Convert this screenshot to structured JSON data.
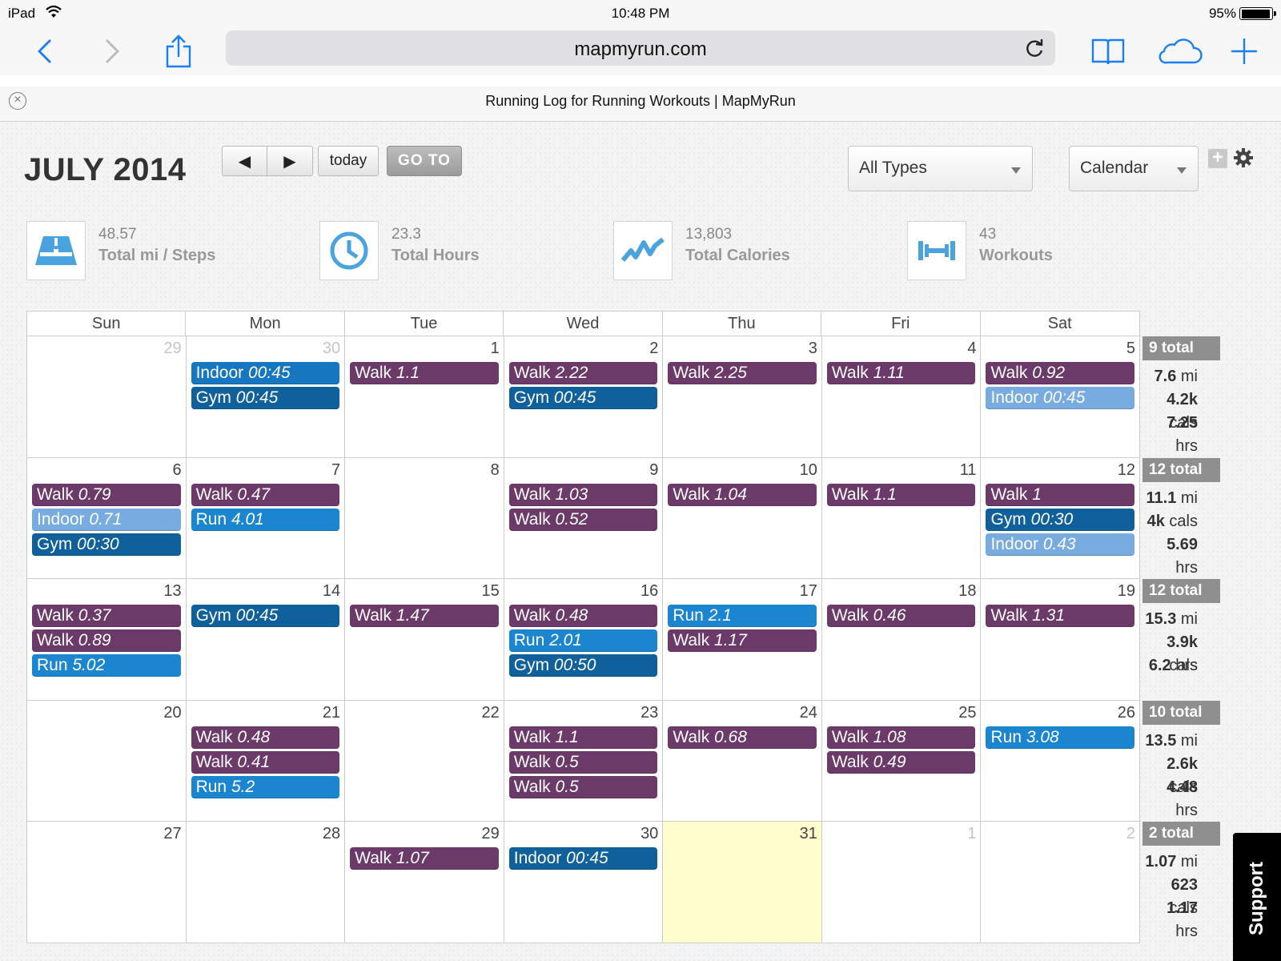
{
  "status_bar": {
    "device": "iPad",
    "time": "10:48 PM",
    "battery": "95%",
    "battery_level": 0.95
  },
  "browser": {
    "url": "mapmyrun.com",
    "tab_title": "Running Log for Running Workouts | MapMyRun"
  },
  "header": {
    "month_title": "JULY 2014",
    "prev_label": "◀",
    "next_label": "▶",
    "today_label": "today",
    "goto_label": "GO TO",
    "type_filter": "All Types",
    "view_select": "Calendar",
    "add_label": "+"
  },
  "stats": [
    {
      "value": "48.57",
      "label": "Total mi / Steps",
      "icon": "road-icon"
    },
    {
      "value": "23.3",
      "label": "Total Hours",
      "icon": "clock-icon"
    },
    {
      "value": "13,803",
      "label": "Total Calories",
      "icon": "pulse-icon"
    },
    {
      "value": "43",
      "label": "Workouts",
      "icon": "dumbbell-icon"
    }
  ],
  "colors": {
    "walk": "#6c3a69",
    "run": "#1b86cf",
    "gym": "#0f609b",
    "indoor": "#78abe0",
    "today_bg": "#fffccd"
  },
  "weekdays": [
    "Sun",
    "Mon",
    "Tue",
    "Wed",
    "Thu",
    "Fri",
    "Sat"
  ],
  "weeks": [
    {
      "days": [
        {
          "num": "29",
          "other": true,
          "events": []
        },
        {
          "num": "30",
          "other": true,
          "events": [
            {
              "type": "indoor-dark",
              "name": "Indoor",
              "value": "00:45"
            },
            {
              "type": "gym",
              "name": "Gym",
              "value": "00:45"
            }
          ]
        },
        {
          "num": "1",
          "events": [
            {
              "type": "walk",
              "name": "Walk",
              "value": "1.1"
            }
          ]
        },
        {
          "num": "2",
          "events": [
            {
              "type": "walk",
              "name": "Walk",
              "value": "2.22"
            },
            {
              "type": "gym",
              "name": "Gym",
              "value": "00:45"
            }
          ]
        },
        {
          "num": "3",
          "events": [
            {
              "type": "walk",
              "name": "Walk",
              "value": "2.25"
            }
          ]
        },
        {
          "num": "4",
          "events": [
            {
              "type": "walk",
              "name": "Walk",
              "value": "1.11"
            }
          ]
        },
        {
          "num": "5",
          "events": [
            {
              "type": "walk",
              "name": "Walk",
              "value": "0.92"
            },
            {
              "type": "indoor",
              "name": "Indoor",
              "value": "00:45"
            }
          ]
        }
      ],
      "total": {
        "badge": "9 total",
        "mi": "7.6",
        "cals": "4.2k",
        "hrs": "7.25"
      }
    },
    {
      "days": [
        {
          "num": "6",
          "events": [
            {
              "type": "walk",
              "name": "Walk",
              "value": "0.79"
            },
            {
              "type": "indoor",
              "name": "Indoor",
              "value": "0.71"
            },
            {
              "type": "gym",
              "name": "Gym",
              "value": "00:30"
            }
          ]
        },
        {
          "num": "7",
          "events": [
            {
              "type": "walk",
              "name": "Walk",
              "value": "0.47"
            },
            {
              "type": "run",
              "name": "Run",
              "value": "4.01"
            }
          ]
        },
        {
          "num": "8",
          "events": []
        },
        {
          "num": "9",
          "events": [
            {
              "type": "walk",
              "name": "Walk",
              "value": "1.03"
            },
            {
              "type": "walk",
              "name": "Walk",
              "value": "0.52"
            }
          ]
        },
        {
          "num": "10",
          "events": [
            {
              "type": "walk",
              "name": "Walk",
              "value": "1.04"
            }
          ]
        },
        {
          "num": "11",
          "events": [
            {
              "type": "walk",
              "name": "Walk",
              "value": "1.1"
            }
          ]
        },
        {
          "num": "12",
          "events": [
            {
              "type": "walk",
              "name": "Walk",
              "value": "1"
            },
            {
              "type": "gym",
              "name": "Gym",
              "value": "00:30"
            },
            {
              "type": "indoor",
              "name": "Indoor",
              "value": "0.43"
            }
          ]
        }
      ],
      "total": {
        "badge": "12 total",
        "mi": "11.1",
        "cals": "4k",
        "hrs": "5.69"
      }
    },
    {
      "days": [
        {
          "num": "13",
          "events": [
            {
              "type": "walk",
              "name": "Walk",
              "value": "0.37"
            },
            {
              "type": "walk",
              "name": "Walk",
              "value": "0.89"
            },
            {
              "type": "run",
              "name": "Run",
              "value": "5.02"
            }
          ]
        },
        {
          "num": "14",
          "events": [
            {
              "type": "gym",
              "name": "Gym",
              "value": "00:45"
            }
          ]
        },
        {
          "num": "15",
          "events": [
            {
              "type": "walk",
              "name": "Walk",
              "value": "1.47"
            }
          ]
        },
        {
          "num": "16",
          "events": [
            {
              "type": "walk",
              "name": "Walk",
              "value": "0.48"
            },
            {
              "type": "run",
              "name": "Run",
              "value": "2.01"
            },
            {
              "type": "gym",
              "name": "Gym",
              "value": "00:50"
            }
          ]
        },
        {
          "num": "17",
          "events": [
            {
              "type": "run",
              "name": "Run",
              "value": "2.1"
            },
            {
              "type": "walk",
              "name": "Walk",
              "value": "1.17"
            }
          ]
        },
        {
          "num": "18",
          "events": [
            {
              "type": "walk",
              "name": "Walk",
              "value": "0.46"
            }
          ]
        },
        {
          "num": "19",
          "events": [
            {
              "type": "walk",
              "name": "Walk",
              "value": "1.31"
            }
          ]
        }
      ],
      "total": {
        "badge": "12 total",
        "mi": "15.3",
        "cals": "3.9k",
        "hrs": "6.2"
      }
    },
    {
      "days": [
        {
          "num": "20",
          "events": []
        },
        {
          "num": "21",
          "events": [
            {
              "type": "walk",
              "name": "Walk",
              "value": "0.48"
            },
            {
              "type": "walk",
              "name": "Walk",
              "value": "0.41"
            },
            {
              "type": "run",
              "name": "Run",
              "value": "5.2"
            }
          ]
        },
        {
          "num": "22",
          "events": []
        },
        {
          "num": "23",
          "events": [
            {
              "type": "walk",
              "name": "Walk",
              "value": "1.1"
            },
            {
              "type": "walk",
              "name": "Walk",
              "value": "0.5"
            },
            {
              "type": "walk",
              "name": "Walk",
              "value": "0.5"
            }
          ]
        },
        {
          "num": "24",
          "events": [
            {
              "type": "walk",
              "name": "Walk",
              "value": "0.68"
            }
          ]
        },
        {
          "num": "25",
          "events": [
            {
              "type": "walk",
              "name": "Walk",
              "value": "1.08"
            },
            {
              "type": "walk",
              "name": "Walk",
              "value": "0.49"
            }
          ]
        },
        {
          "num": "26",
          "events": [
            {
              "type": "run",
              "name": "Run",
              "value": "3.08"
            }
          ]
        }
      ],
      "total": {
        "badge": "10 total",
        "mi": "13.5",
        "cals": "2.6k",
        "hrs": "4.48"
      }
    },
    {
      "days": [
        {
          "num": "27",
          "events": []
        },
        {
          "num": "28",
          "events": []
        },
        {
          "num": "29",
          "events": [
            {
              "type": "walk",
              "name": "Walk",
              "value": "1.07"
            }
          ]
        },
        {
          "num": "30",
          "events": [
            {
              "type": "gym",
              "name": "Indoor",
              "value": "00:45"
            }
          ]
        },
        {
          "num": "31",
          "today": true,
          "events": []
        },
        {
          "num": "1",
          "other": true,
          "events": []
        },
        {
          "num": "2",
          "other": true,
          "events": []
        }
      ],
      "total": {
        "badge": "2 total",
        "mi": "1.07",
        "cals": "623",
        "hrs": "1.17"
      }
    }
  ],
  "units": {
    "mi": "mi",
    "cals": "cals",
    "hrs": "hrs"
  },
  "support_label": "Support"
}
